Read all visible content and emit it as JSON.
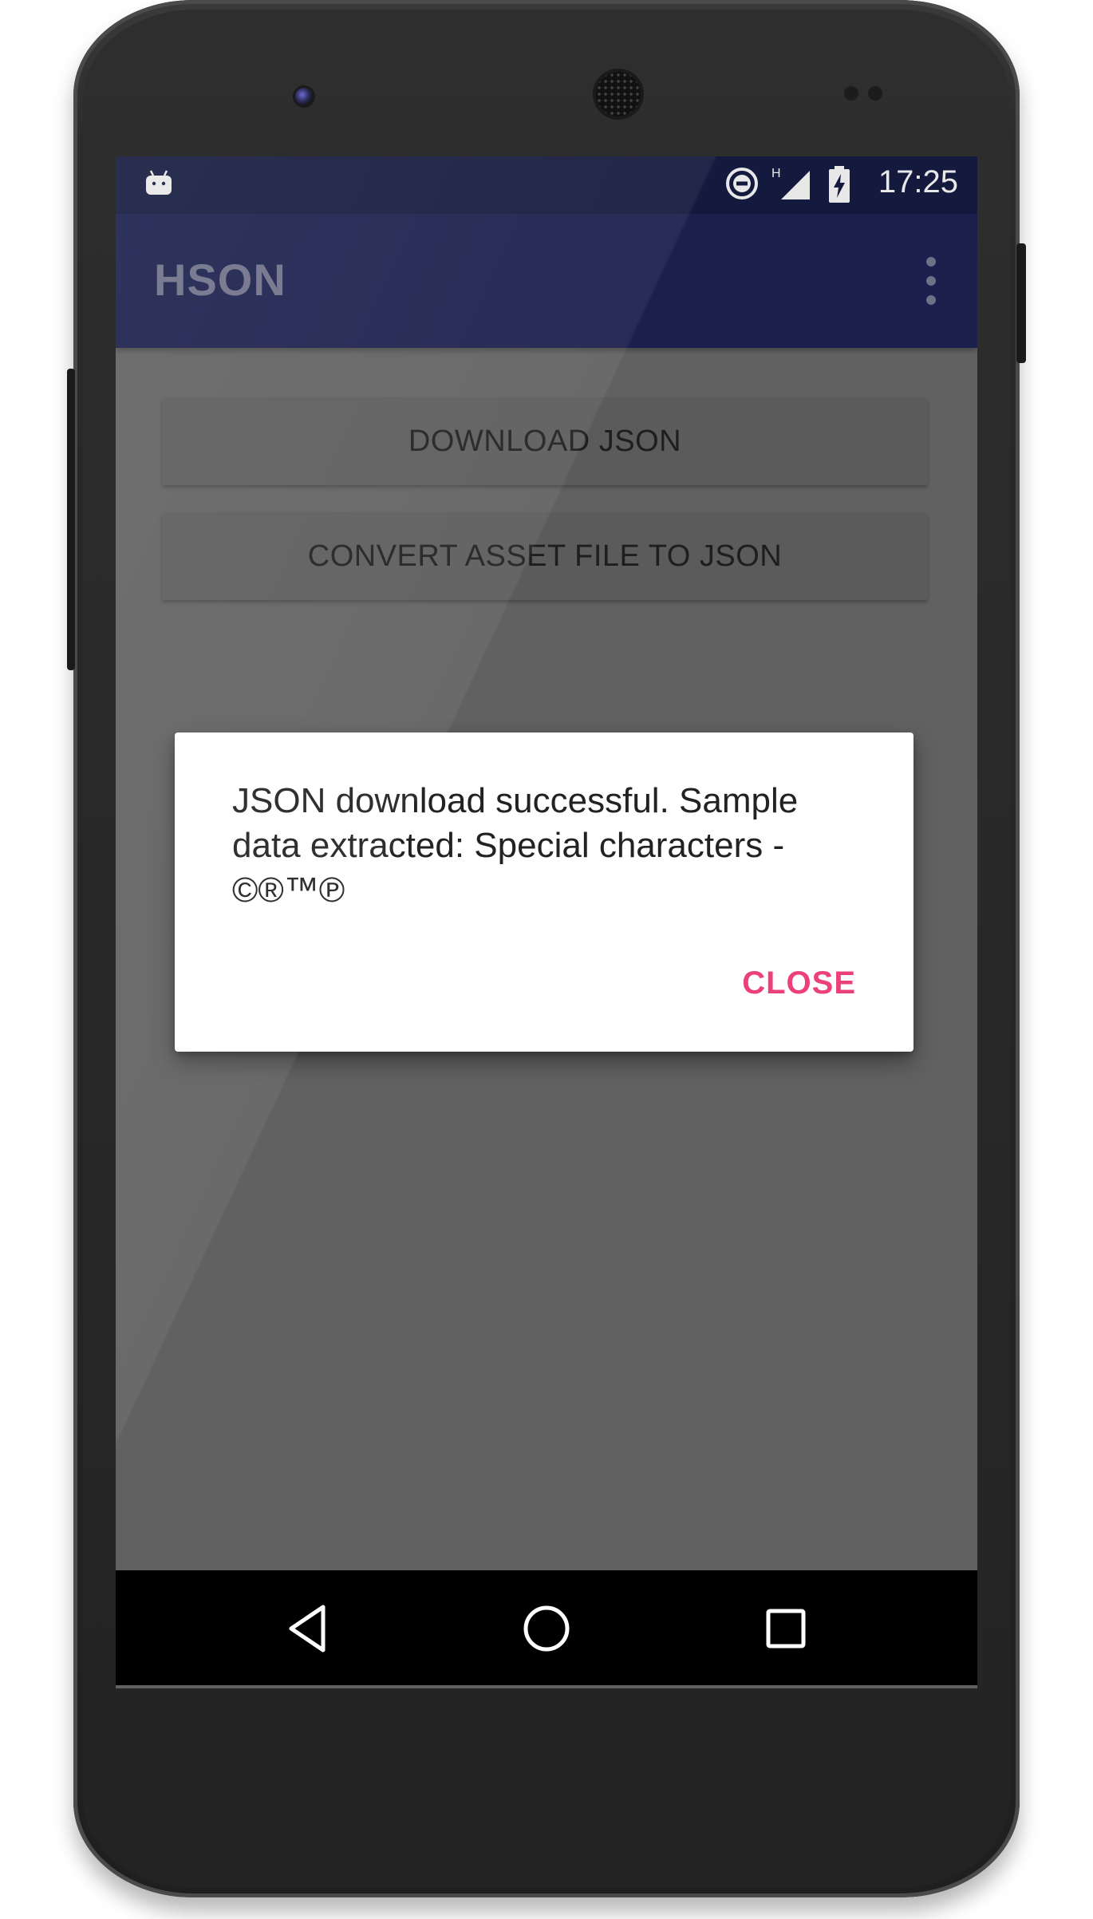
{
  "status_bar": {
    "time": "17:25",
    "network_type": "H",
    "icons": [
      "android-debug-icon",
      "do-not-disturb-icon",
      "signal-icon",
      "battery-charging-icon"
    ]
  },
  "app_bar": {
    "title": "HSON",
    "menu_icon": "more-vert-icon"
  },
  "main": {
    "download_button_label": "DOWNLOAD JSON",
    "convert_button_label": "CONVERT ASSET FILE TO JSON"
  },
  "dialog": {
    "message": "JSON download successful. Sample data extracted: Special characters - ©®™℗",
    "close_label": "CLOSE"
  },
  "nav_bar": {
    "icons": [
      "back-icon",
      "home-icon",
      "recents-icon"
    ]
  },
  "colors": {
    "app_bar": "#1a1f4c",
    "status_bar": "#141a3e",
    "screen_dim": "#616161",
    "dialog_accent": "#ec407a"
  }
}
